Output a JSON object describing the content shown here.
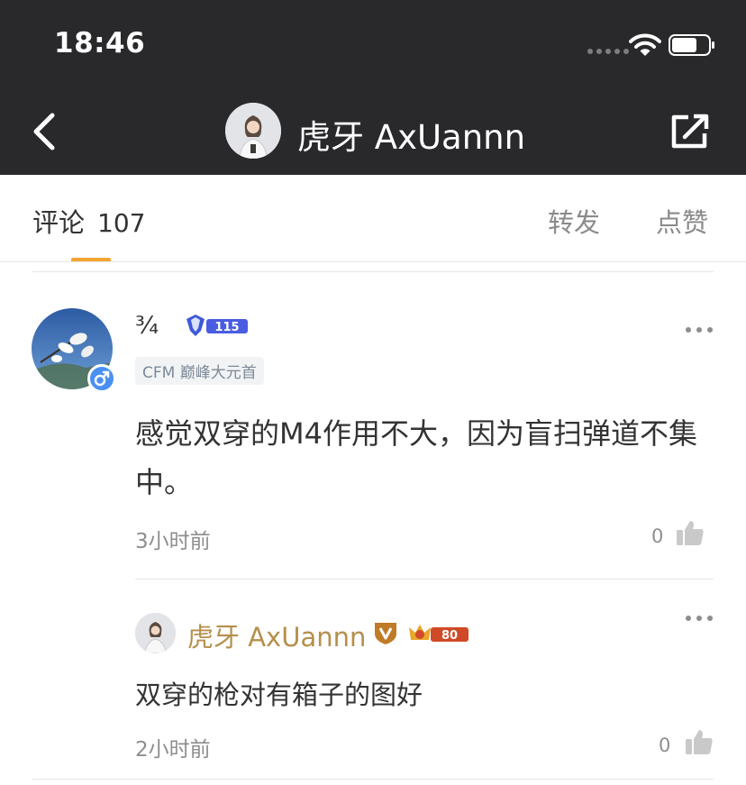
{
  "status_bar": {
    "time": "18:46"
  },
  "nav": {
    "title": "虎牙 AxUannn"
  },
  "tabs": {
    "comments_label": "评论",
    "comments_count": "107",
    "reposts_label": "转发",
    "likes_label": "点赞"
  },
  "comment": {
    "username": "¾",
    "level_number": "115",
    "tag": "CFM 巅峰大元首",
    "text": "感觉双穿的M4作用不大，因为盲扫弹道不集中。",
    "time": "3小时前",
    "likes": "0"
  },
  "reply": {
    "username": "虎牙 AxUannn",
    "level_number": "80",
    "text": "双穿的枪对有箱子的图好",
    "time": "2小时前",
    "likes": "0"
  },
  "colors": {
    "header_bg": "#29292b",
    "accent": "#f3a531",
    "reply_name": "#b58f4c",
    "gender_badge": "#4a90f2"
  }
}
